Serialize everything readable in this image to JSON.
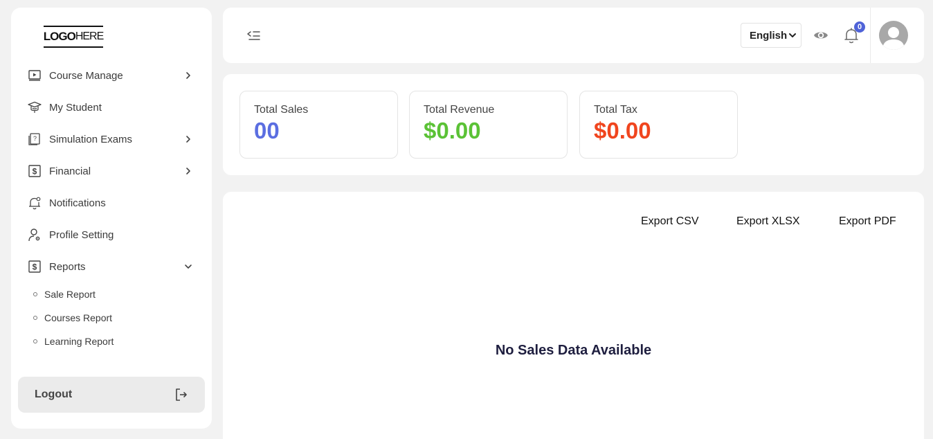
{
  "logo": {
    "bold": "LOGO",
    "thin": "HERE"
  },
  "sidebar": {
    "items": [
      {
        "label": "Course Manage",
        "icon": "video-icon",
        "has_chevron": true
      },
      {
        "label": "My Student",
        "icon": "graduation-cap-icon",
        "has_chevron": false
      },
      {
        "label": "Simulation Exams",
        "icon": "question-sheet-icon",
        "has_chevron": true
      },
      {
        "label": "Financial",
        "icon": "dollar-box-icon",
        "has_chevron": true
      },
      {
        "label": "Notifications",
        "icon": "bell-icon",
        "has_chevron": false
      },
      {
        "label": "Profile Setting",
        "icon": "user-gear-icon",
        "has_chevron": false
      },
      {
        "label": "Reports",
        "icon": "dollar-box-icon",
        "has_chevron": true,
        "expanded": true
      }
    ],
    "sub_items": [
      {
        "label": "Sale Report"
      },
      {
        "label": "Courses Report"
      },
      {
        "label": "Learning Report"
      }
    ],
    "logout_label": "Logout"
  },
  "header": {
    "language": "English",
    "notification_count": "0"
  },
  "stats": [
    {
      "title": "Total Sales",
      "value": "00",
      "color": "#5b6ee1"
    },
    {
      "title": "Total Revenue",
      "value": "$0.00",
      "color": "#5bc236"
    },
    {
      "title": "Total Tax",
      "value": "$0.00",
      "color": "#f0451e"
    }
  ],
  "exports": {
    "csv": "Export CSV",
    "xlsx": "Export XLSX",
    "pdf": "Export PDF"
  },
  "empty_message": "No Sales Data Available"
}
